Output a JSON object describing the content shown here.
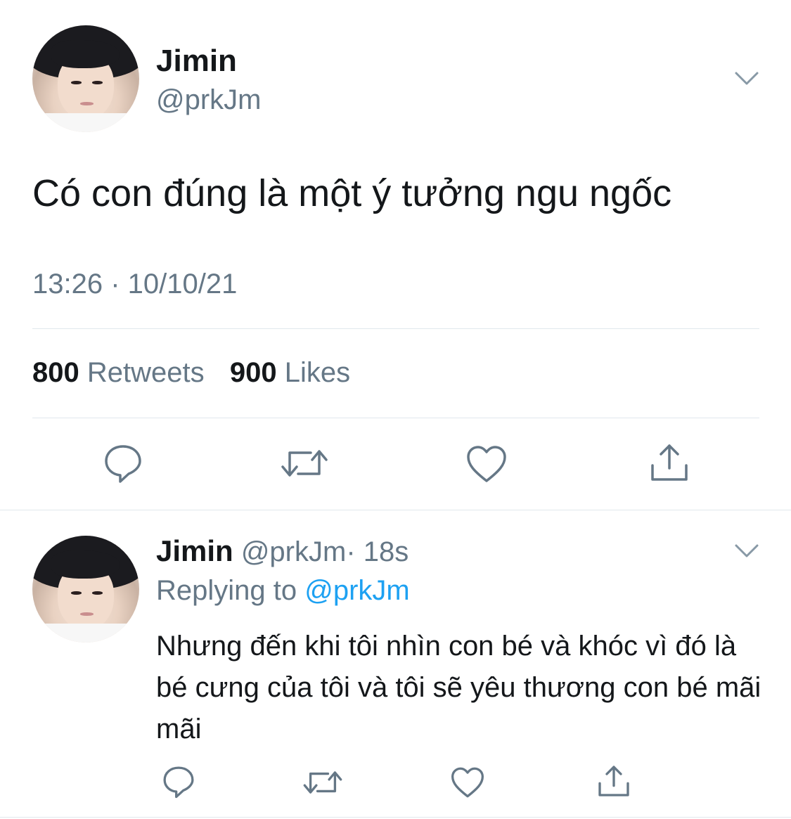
{
  "tweet": {
    "author_name": "Jimin",
    "author_handle": "@prkJm",
    "text": "Có con đúng là một ý tưởng ngu ngốc",
    "timestamp": "13:26 · 10/10/21",
    "retweets_count": "800",
    "retweets_label": "Retweets",
    "likes_count": "900",
    "likes_label": "Likes",
    "actions": [
      "reply-icon",
      "retweet-icon",
      "like-icon",
      "share-icon"
    ]
  },
  "reply": {
    "author_name": "Jimin",
    "author_handle": "@prkJm",
    "time_ago": "· 18s",
    "replying_prefix": "Replying to",
    "replying_to": "@prkJm",
    "text": "Nhưng đến khi tôi nhìn con bé và khóc vì đó là bé cưng của tôi và tôi sẽ yêu thương con bé mãi mãi",
    "actions": [
      "reply-icon",
      "retweet-icon",
      "like-icon",
      "share-icon"
    ]
  },
  "colors": {
    "text": "#14171a",
    "muted": "#657786",
    "accent": "#1da1f2",
    "divider": "#e1e8ed"
  }
}
